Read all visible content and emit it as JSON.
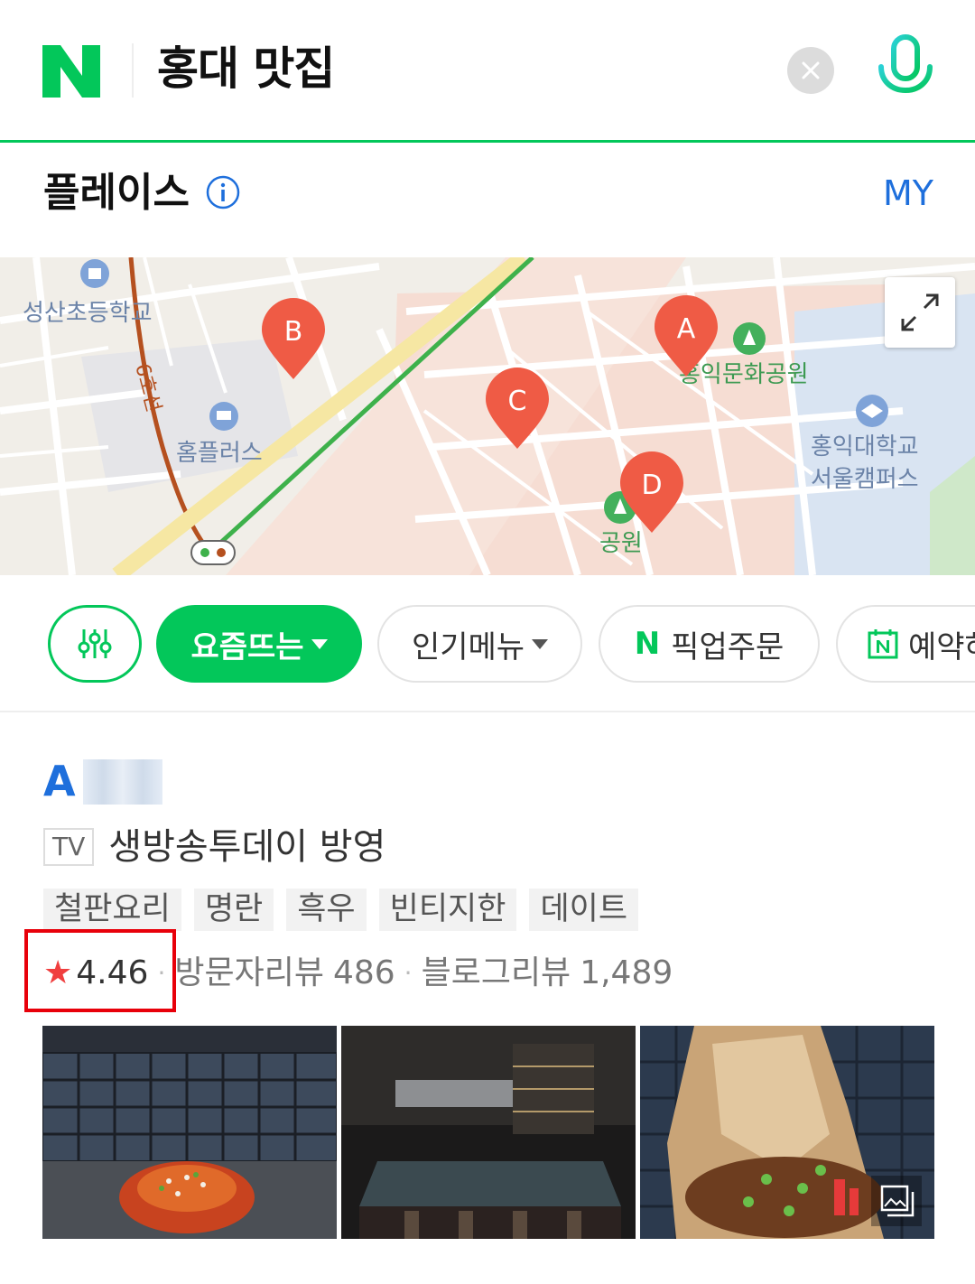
{
  "search": {
    "query": "홍대 맛집",
    "brand_color": "#03c75a"
  },
  "section": {
    "title": "플레이스",
    "my_label": "MY"
  },
  "map": {
    "labels": {
      "school1": "성산초등학교",
      "line": "6호선",
      "mall": "홈플러스",
      "park1": "홍익문화공원",
      "univ_line1": "홍익대학교",
      "univ_line2": "서울캠퍼스",
      "park2": "공원"
    },
    "markers": [
      "A",
      "B",
      "C",
      "D"
    ],
    "marker_color": "#ef5b45"
  },
  "filters": {
    "trending": "요즘뜨는",
    "popular_menu": "인기메뉴",
    "pickup": "픽업주문",
    "pickup_prefix": "N",
    "reservation": "예약하"
  },
  "result": {
    "marker": "A",
    "tv_badge": "TV",
    "tv_text": "생방송투데이 방영",
    "tags": [
      "철판요리",
      "명란",
      "흑우",
      "빈티지한",
      "데이트"
    ],
    "rating": "4.46",
    "visitor_reviews_label": "방문자리뷰",
    "visitor_reviews_count": "486",
    "blog_reviews_label": "블로그리뷰",
    "blog_reviews_count": "1,489",
    "highlight_color": "#e8000a"
  }
}
